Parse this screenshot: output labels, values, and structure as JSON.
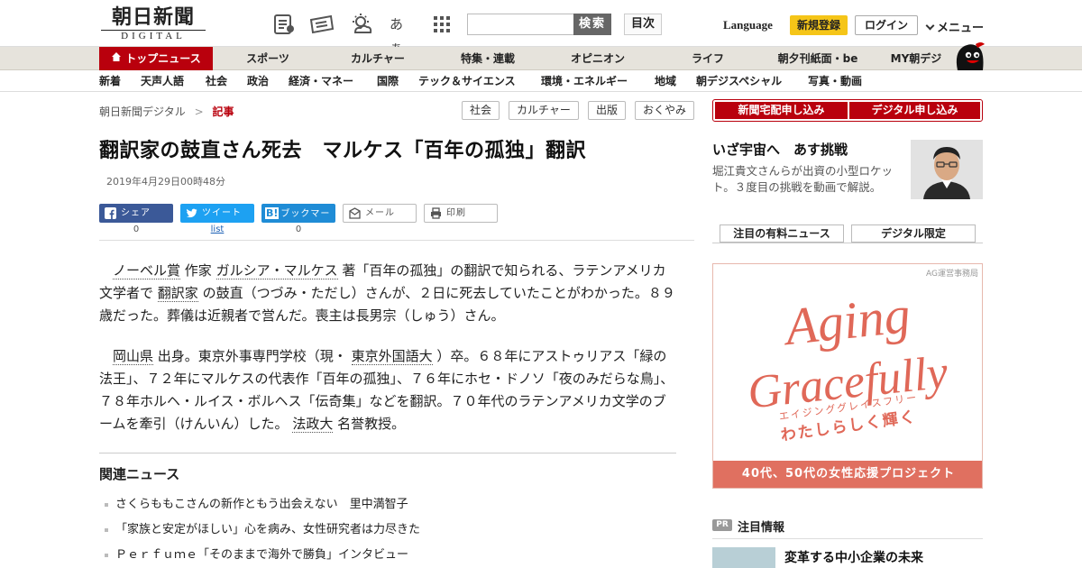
{
  "header": {
    "logo_main": "朝日新聞",
    "logo_sub": "DIGITAL",
    "search_button": "検索",
    "toc_button": "目次",
    "language": "Language",
    "register": "新規登録",
    "login": "ログイン",
    "menu": "メニュー",
    "font_toggle": "あぁ"
  },
  "nav_primary": [
    {
      "label": "トップニュース",
      "active": true
    },
    {
      "label": "スポーツ"
    },
    {
      "label": "カルチャー"
    },
    {
      "label": "特集・連載"
    },
    {
      "label": "オピニオン"
    },
    {
      "label": "ライフ"
    },
    {
      "label": "朝夕刊紙面・be"
    },
    {
      "label": "MY朝デジ"
    }
  ],
  "nav_secondary": [
    "新着",
    "天声人語",
    "社会",
    "政治",
    "経済・マネー",
    "国際",
    "テック＆サイエンス",
    "環境・エネルギー",
    "地域",
    "朝デジスペシャル",
    "写真・動画"
  ],
  "breadcrumb": {
    "home": "朝日新聞デジタル",
    "sep": ">",
    "current": "記事"
  },
  "tags": [
    "社会",
    "カルチャー",
    "出版",
    "おくやみ"
  ],
  "article": {
    "headline": "翻訳家の鼓直さん死去　マルケス「百年の孤独」翻訳",
    "date": "2019年4月29日00時48分",
    "share": [
      {
        "label": "シェア",
        "count": "0"
      },
      {
        "label": "ツイート",
        "count": "list"
      },
      {
        "label": "ブックマーク",
        "count": "0",
        "prefix": "B!"
      },
      {
        "label": "メール"
      },
      {
        "label": "印刷"
      }
    ],
    "p1": {
      "k1": "ノーベル賞",
      "t1": " 作家 ",
      "k2": "ガルシア・マルケス",
      "t2": " 著「百年の孤独」の翻訳で知られる、ラテンアメリカ文学者で ",
      "k3": "翻訳家",
      "t3": " の鼓直（つづみ・ただし）さんが、２日に死去していたことがわかった。８９歳だった。葬儀は近親者で営んだ。喪主は長男宗（しゅう）さん。"
    },
    "p2": {
      "k1": "岡山県",
      "t1": " 出身。東京外事専門学校（現・ ",
      "k2": "東京外国語大",
      "t2": " ）卒。６８年にアストゥリアス「緑の法王」、７２年にマルケスの代表作「百年の孤独」、７６年にホセ・ドノソ「夜のみだらな鳥」、７８年ホルヘ・ルイス・ボルヘス「伝奇集」などを翻訳。７０年代のラテンアメリカ文学のブームを牽引（けんいん）した。 ",
      "k3": "法政大",
      "t3": " 名誉教授。"
    }
  },
  "related": {
    "title": "関連ニュース",
    "items": [
      "さくらももこさんの新作ともう出会えない　里中満智子",
      "「家族と安定がほしい」心を病み、女性研究者は力尽きた",
      "Ｐｅｒｆｕｍｅ「そのままで海外で勝負」インタビュー"
    ]
  },
  "sidebar": {
    "subscribe_paper": "新聞宅配申し込み",
    "subscribe_digital": "デジタル申し込み",
    "feature_title": "いざ宇宙へ　あす挑戦",
    "feature_text": "堀江貴文さんらが出資の小型ロケット。３度目の挑戦を動画で解説。",
    "tabs": [
      "注目の有料ニュース",
      "デジタル限定"
    ],
    "ad": {
      "office": "AG運営事務局",
      "line1": "Aging",
      "line2": "Gracefully",
      "kana": "エイジンググレイスフリー",
      "jp": "わたしらしく輝く",
      "bottom": "40代、50代の女性応援プロジェクト"
    },
    "pr": {
      "badge": "PR",
      "title": "注目情報",
      "item": "変革する中小企業の未来"
    }
  },
  "colors": {
    "brand_red": "#b9000d",
    "register_yellow": "#f5c518",
    "ad_coral": "#e07060"
  }
}
